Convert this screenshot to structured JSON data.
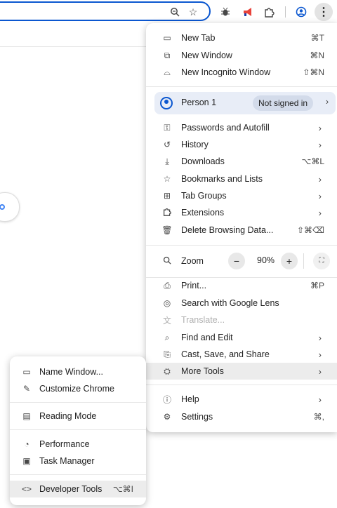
{
  "toolbar": {
    "icons": [
      "zoom-icon",
      "bookmark-star-icon",
      "bug-extension-icon",
      "megaphone-extension-icon",
      "extensions-puzzle-icon",
      "profile-icon",
      "more-menu-icon"
    ]
  },
  "menu": {
    "new_tab": {
      "label": "New Tab",
      "shortcut": "⌘T"
    },
    "new_window": {
      "label": "New Window",
      "shortcut": "⌘N"
    },
    "incognito": {
      "label": "New Incognito Window",
      "shortcut": "⇧⌘N"
    },
    "profile": {
      "name": "Person 1",
      "status": "Not signed in"
    },
    "passwords": {
      "label": "Passwords and Autofill"
    },
    "history": {
      "label": "History"
    },
    "downloads": {
      "label": "Downloads",
      "shortcut": "⌥⌘L"
    },
    "bookmarks": {
      "label": "Bookmarks and Lists"
    },
    "tab_groups": {
      "label": "Tab Groups"
    },
    "extensions": {
      "label": "Extensions"
    },
    "delete_data": {
      "label": "Delete Browsing Data...",
      "shortcut": "⇧⌘⌫"
    },
    "zoom": {
      "label": "Zoom",
      "minus": "−",
      "value": "90%",
      "plus": "+"
    },
    "print": {
      "label": "Print...",
      "shortcut": "⌘P"
    },
    "lens": {
      "label": "Search with Google Lens"
    },
    "translate": {
      "label": "Translate..."
    },
    "find_edit": {
      "label": "Find and Edit"
    },
    "cast_save": {
      "label": "Cast, Save, and Share"
    },
    "more_tools": {
      "label": "More Tools"
    },
    "help": {
      "label": "Help"
    },
    "settings": {
      "label": "Settings",
      "shortcut": "⌘,"
    }
  },
  "submenu": {
    "name_window": {
      "label": "Name Window..."
    },
    "customize": {
      "label": "Customize Chrome"
    },
    "reading_mode": {
      "label": "Reading Mode"
    },
    "performance": {
      "label": "Performance"
    },
    "task_manager": {
      "label": "Task Manager"
    },
    "dev_tools": {
      "label": "Developer Tools",
      "shortcut": "⌥⌘I"
    }
  },
  "colors": {
    "accent": "#0b57d0",
    "highlight": "#ececec",
    "profile_bg": "#e8edf7"
  }
}
